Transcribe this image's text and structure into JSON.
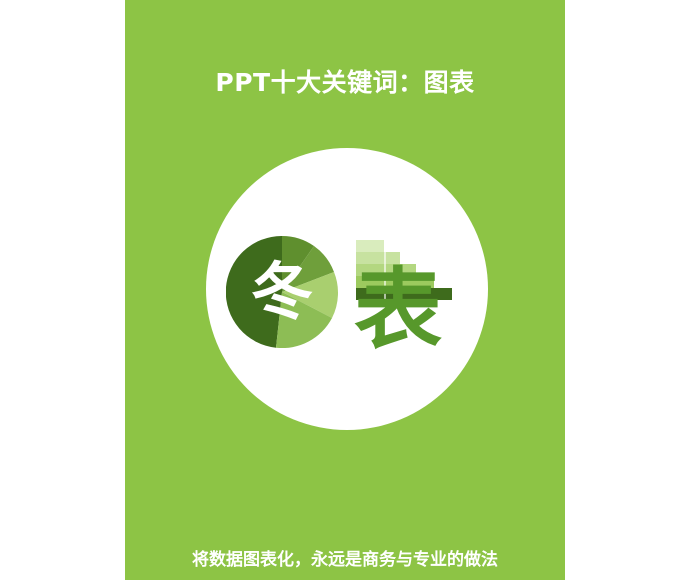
{
  "poster": {
    "title": "PPT十大关键词：图表",
    "subtitle": "将数据图表化，永远是商务与专业的做法",
    "logo": {
      "pie_char": "冬",
      "bars_char": "表"
    },
    "colors": {
      "background": "#8dc445",
      "circle": "#ffffff",
      "text": "#ffffff",
      "pie_dark": "#3e6b1c",
      "pie_mid": "#5f8f2e",
      "pie_light": "#a9cf6f",
      "bar_light": "#cde4a8",
      "bar_mid": "#a2cd66",
      "bar_dark": "#57982b"
    }
  }
}
